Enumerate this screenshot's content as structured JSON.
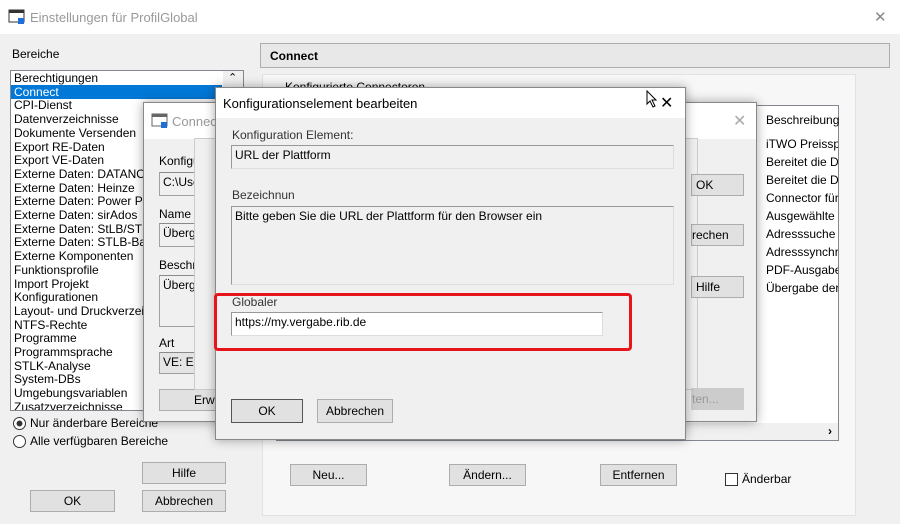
{
  "main_window": {
    "title": "Einstellungen für ProfilGlobal",
    "close": "✕"
  },
  "left": {
    "label": "Bereiche",
    "items": [
      "Berechtigungen",
      "Connect",
      "CPI-Dienst",
      "Datenverzeichnisse",
      "Dokumente Versenden",
      "Export RE-Daten",
      "Export VE-Daten",
      "Externe Daten: DATANORM",
      "Externe Daten: Heinze",
      "Externe Daten: Power Project",
      "Externe Daten: sirAdos",
      "Externe Daten: StLB/STLK",
      "Externe Daten: STLB-Bau",
      "Externe Komponenten",
      "Funktionsprofile",
      "Import Projekt",
      "Konfigurationen",
      "Layout- und Druckverzeichnisse",
      "NTFS-Rechte",
      "Programme",
      "Programmsprache",
      "STLK-Analyse",
      "System-DBs",
      "Umgebungsvariablen",
      "Zusatzverzeichnisse"
    ],
    "selected": "Connect",
    "radio_1": "Nur änderbare Bereiche",
    "radio_2": "Alle verfügbaren Bereiche",
    "radio_selected": "Nur änderbare Bereiche",
    "help": "Hilfe",
    "ok": "OK",
    "cancel": "Abbrechen"
  },
  "right": {
    "header": "Connect",
    "group": "Konfigurierte Connectoren",
    "column": "Beschreibung",
    "rows": [
      "iTWO Preisspiegel",
      "Bereitet die Daten",
      "Bereitet die Daten",
      "Connector für",
      "Ausgewählte B",
      "Adresssuche in",
      "Adresssynchro",
      "PDF-Ausgabe",
      "Übergabe der"
    ],
    "new": "Neu...",
    "edit": "Ändern...",
    "remove": "Entfernen",
    "changeable": "Änderbar",
    "changeable_checked": false
  },
  "connect_dialog": {
    "title": "Connect",
    "konfig_label": "Konfigura",
    "konfig_value": "C:\\Users",
    "name_label": "Name",
    "name_value": "Übergab",
    "desc_label": "Beschrei",
    "desc_value": "Übergab",
    "art_label": "Art",
    "art_value": "VE: Exp",
    "extended": "Erweite",
    "ok": "OK",
    "cancel": "rechen",
    "help": "Hilfe",
    "disabled_btn": "ten..."
  },
  "edit_dialog": {
    "title": "Konfigurationselement bearbeiten",
    "element_label": "Konfiguration Element:",
    "element_value": "URL der Plattform",
    "desc_label": "Bezeichnun",
    "desc_value": "Bitte geben Sie die URL der Plattform für den Browser ein",
    "global_label": "Globaler",
    "global_value": "https://my.vergabe.rib.de",
    "ok": "OK",
    "cancel": "Abbrechen",
    "highlight_color": "#e8141c"
  }
}
